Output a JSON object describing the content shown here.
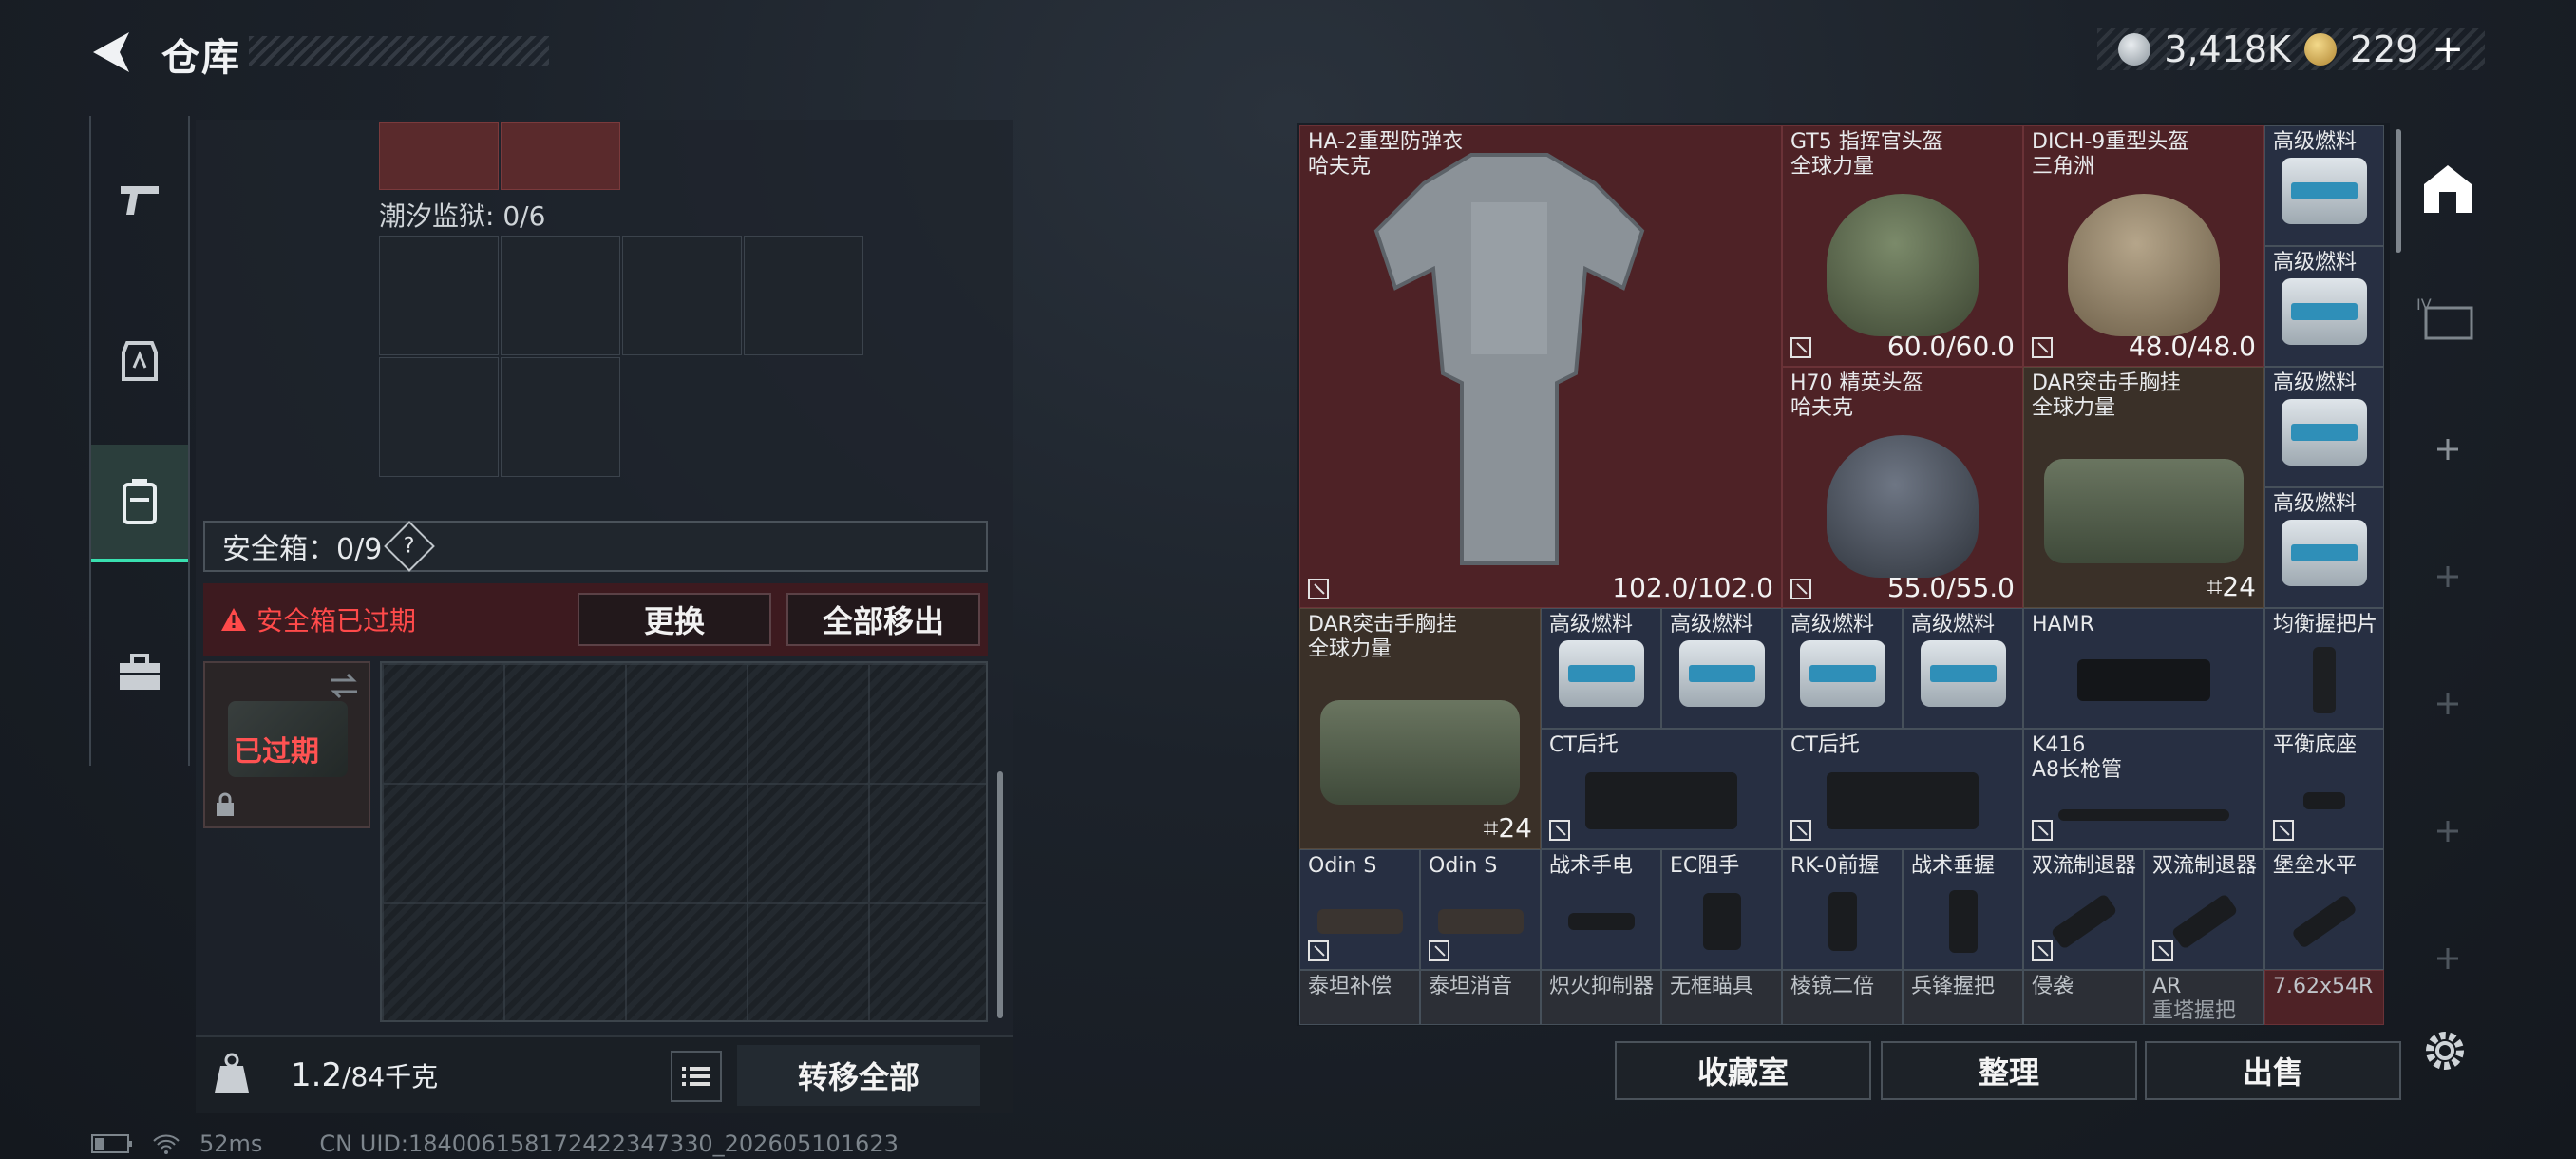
{
  "header": {
    "title": "仓库",
    "silver": "3,418K",
    "gold": "229"
  },
  "left": {
    "tide_label": "潮汐监狱: 0/6",
    "secure_box_label": "安全箱：0/9",
    "secure_help": "?",
    "warning": "安全箱已过期",
    "replace_button": "更换",
    "remove_all_button": "全部移出",
    "expired_label": "已过期",
    "weight_value": "1.2",
    "weight_max": "/84千克",
    "transfer_all_button": "转移全部"
  },
  "inventory": {
    "vest": {
      "name": "HA-2重型防弹衣",
      "sub": "哈夫克",
      "dur": "102.0/102.0"
    },
    "helm1": {
      "name": "GT5 指挥官头盔",
      "sub": "全球力量",
      "dur": "60.0/60.0"
    },
    "helm2": {
      "name": "DICH-9重型头盔",
      "sub": "三角洲",
      "dur": "48.0/48.0"
    },
    "helm3": {
      "name": "H70 精英头盔",
      "sub": "哈夫克",
      "dur": "55.0/55.0"
    },
    "rig1": {
      "name": "DAR突击手胸挂",
      "sub": "全球力量",
      "count": "24"
    },
    "rig2": {
      "name": "DAR突击手胸挂",
      "sub": "全球力量",
      "count": "24"
    },
    "fuel": "高级燃料",
    "hamr": "HAMR",
    "grip_plate": "均衡握把片",
    "ct_stock": "CT后托",
    "k416": {
      "name": "K416",
      "sub": "A8长枪管"
    },
    "balance_base": "平衡底座",
    "odin": "Odin S",
    "flashlight": "战术手电",
    "ec": "EC阻手",
    "rk0": "RK-0前握",
    "vert_grip": "战术垂握",
    "dual_brake": "双流制退器",
    "fort_level": "堡垒水平",
    "row5": [
      "泰坦补偿",
      "泰坦消音",
      "炽火抑制器",
      "无框瞄具",
      "棱镜二倍",
      "兵锋握把",
      "侵袭",
      "AR",
      "7.62x54R"
    ],
    "row5_sub": {
      "ar": "重塔握把"
    }
  },
  "actions": {
    "collection": "收藏室",
    "sort": "整理",
    "sell": "出售"
  },
  "status": {
    "ping": "52ms",
    "uid": "CN UID:18400615817242234733​0_202605101623"
  }
}
